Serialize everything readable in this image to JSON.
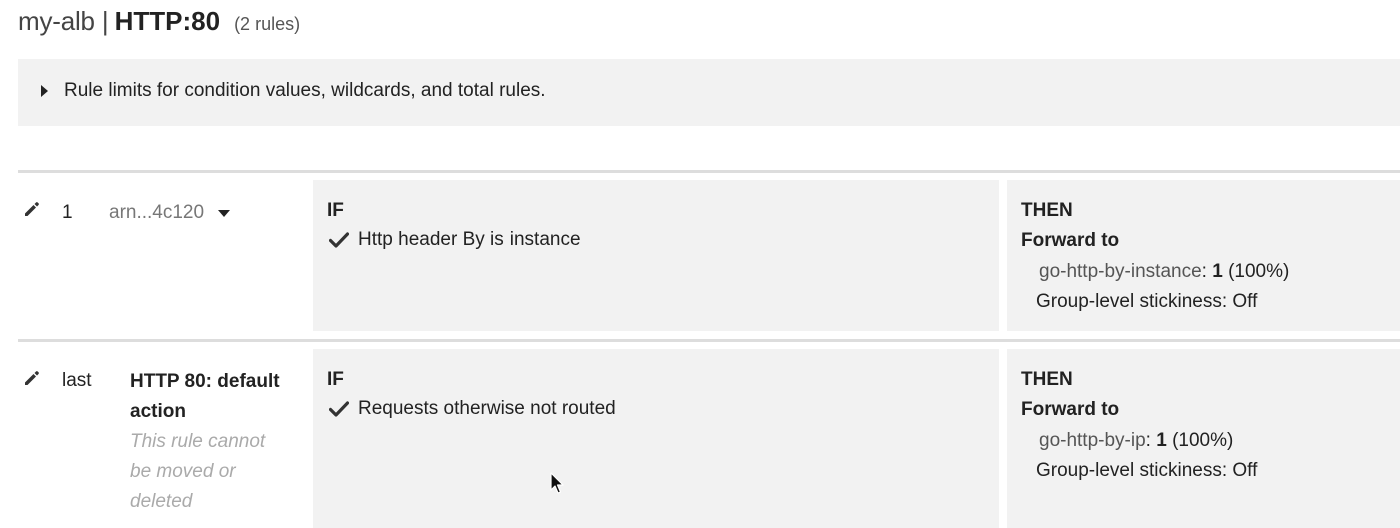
{
  "header": {
    "load_balancer": "my-alb",
    "separator": "|",
    "listener": "HTTP:80",
    "rule_count": "(2 rules)"
  },
  "info": {
    "text": "Rule limits for condition values, wildcards, and total rules."
  },
  "rules": [
    {
      "priority": "1",
      "arn": "arn...4c120",
      "if_label": "IF",
      "condition": {
        "prefix": "Http header By is",
        "value": "instance"
      },
      "then_label": "THEN",
      "action": "Forward to",
      "target_group": "go-http-by-instance",
      "colon": ": ",
      "weight": "1",
      "percent": "(100%)",
      "stickiness": "Group-level stickiness: Off"
    },
    {
      "priority": "last",
      "name_line1": "HTTP 80: default",
      "name_line2": "action",
      "note_line1": "This rule cannot",
      "note_line2": "be moved or",
      "note_line3": "deleted",
      "if_label": "IF",
      "condition": {
        "text": "Requests otherwise not routed"
      },
      "then_label": "THEN",
      "action": "Forward to",
      "target_group": "go-http-by-ip",
      "colon": ": ",
      "weight": "1",
      "percent": "(100%)",
      "stickiness": "Group-level stickiness: Off"
    }
  ],
  "icons": {
    "edit": "pencil-icon",
    "check": "checkmark-icon",
    "expand": "caret-right-icon",
    "dropdown": "caret-down-icon",
    "cursor": "mouse-pointer"
  },
  "colors": {
    "panel_bg": "#f2f2f2",
    "divider": "#dddddd",
    "muted_text": "#aaaaaa"
  }
}
